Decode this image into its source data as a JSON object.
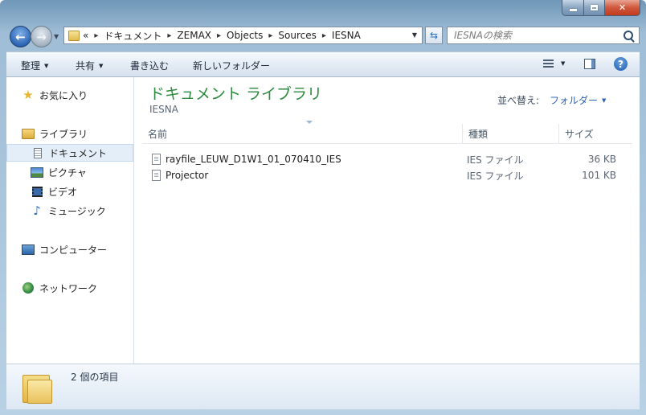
{
  "address": {
    "overflow": "«",
    "crumbs": [
      "ドキュメント",
      "ZEMAX",
      "Objects",
      "Sources",
      "IESNA"
    ]
  },
  "search": {
    "placeholder": "IESNAの検索"
  },
  "toolbar": {
    "organize": "整理",
    "share": "共有",
    "burn": "書き込む",
    "new_folder": "新しいフォルダー"
  },
  "nav": {
    "favorites": "お気に入り",
    "libraries": "ライブラリ",
    "documents": "ドキュメント",
    "pictures": "ピクチャ",
    "videos": "ビデオ",
    "music": "ミュージック",
    "computer": "コンピューター",
    "network": "ネットワーク"
  },
  "library": {
    "title": "ドキュメント ライブラリ",
    "subtitle": "IESNA",
    "arrange_label": "並べ替え:",
    "arrange_value": "フォルダー"
  },
  "columns": {
    "name": "名前",
    "type": "種類",
    "size": "サイズ"
  },
  "files": [
    {
      "name": "rayfile_LEUW_D1W1_01_070410_IES",
      "type": "IES ファイル",
      "size": "36 KB"
    },
    {
      "name": "Projector",
      "type": "IES ファイル",
      "size": "101 KB"
    }
  ],
  "details": {
    "count": "2 個の項目"
  }
}
